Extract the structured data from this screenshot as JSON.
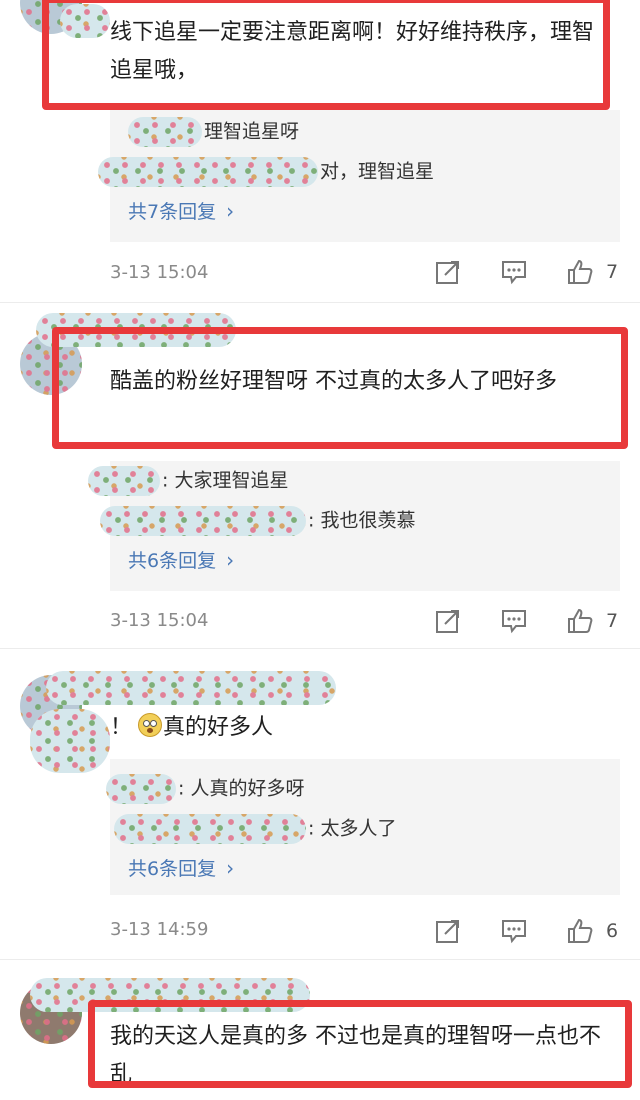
{
  "colors": {
    "highlight": "#e8393a",
    "link": "#4a78b5",
    "meta": "#8a8a8a",
    "reply_bg": "#f4f4f4"
  },
  "comments": [
    {
      "text": "线下追星一定要注意距离啊！好好维持秩序，理智追星哦，",
      "replies": [
        {
          "text": "理智追星呀"
        },
        {
          "text": "对，理智追星"
        }
      ],
      "more_label": "共7条回复",
      "time": "3-13 15:04",
      "likes": "7"
    },
    {
      "text": "酷盖的粉丝好理智呀  不过真的太多人了吧好多",
      "replies": [
        {
          "text": ": 大家理智追星"
        },
        {
          "text": ": 我也很羡慕"
        }
      ],
      "more_label": "共6条回复",
      "time": "3-13 15:04",
      "likes": "7"
    },
    {
      "text_prefix": "！",
      "text": "真的好多人",
      "emoji": "astonished-face-emoji",
      "replies": [
        {
          "text": ": 人真的好多呀"
        },
        {
          "text": ": 太多人了"
        }
      ],
      "more_label": "共6条回复",
      "time": "3-13 14:59",
      "likes": "6"
    },
    {
      "text": "我的天这人是真的多  不过也是真的理智呀一点也不乱"
    }
  ],
  "icons": {
    "share": "share-icon",
    "comment": "comment-icon",
    "like": "thumbs-up-icon",
    "more": "chevron-right-icon"
  }
}
